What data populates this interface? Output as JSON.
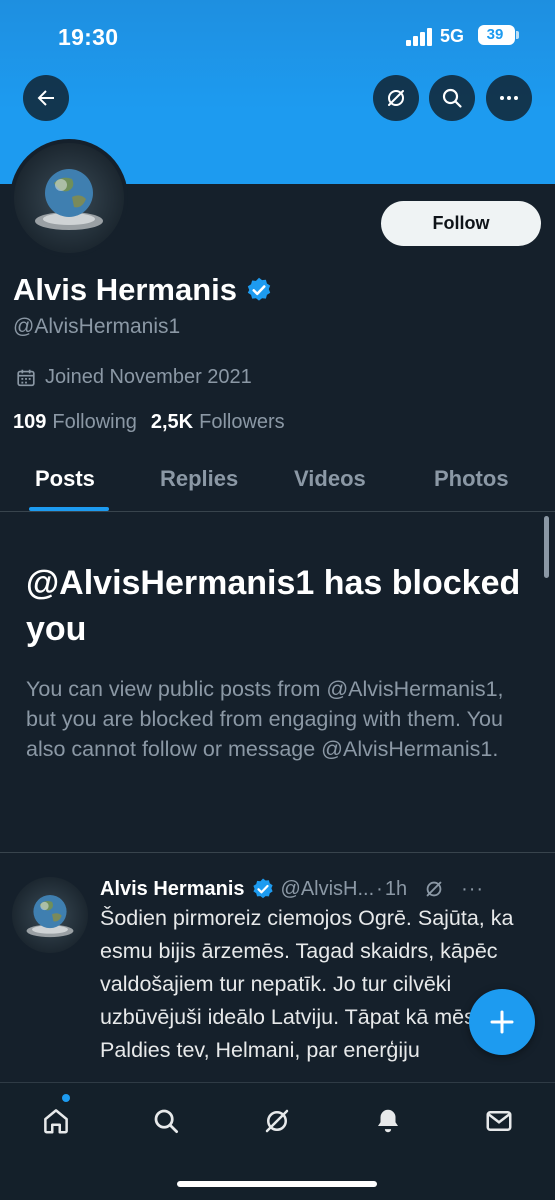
{
  "status_bar": {
    "time": "19:30",
    "network": "5G",
    "battery": "39"
  },
  "header": {
    "back_icon": "arrow-left-icon",
    "grok_icon": "grok-icon",
    "search_icon": "search-icon",
    "more_icon": "more-icon"
  },
  "profile": {
    "follow_label": "Follow",
    "display_name": "Alvis Hermanis",
    "handle": "@AlvisHermanis1",
    "joined": "Joined November 2021",
    "following_count": "109",
    "following_label": "Following",
    "followers_count": "2,5K",
    "followers_label": "Followers"
  },
  "tabs": [
    {
      "label": "Posts",
      "active": true
    },
    {
      "label": "Replies",
      "active": false
    },
    {
      "label": "Videos",
      "active": false
    },
    {
      "label": "Photos",
      "active": false
    }
  ],
  "blocked": {
    "title": "@AlvisHermanis1 has blocked you",
    "description": "You can view public posts from @AlvisHermanis1, but you are blocked from engaging with them. You also cannot follow or message @AlvisHermanis1."
  },
  "post": {
    "name": "Alvis Hermanis",
    "handle": "@AlvisH...",
    "dot": "·",
    "time": "1h",
    "more": "···",
    "text": "Šodien pirmoreiz ciemojos Ogrē. Sajūta, ka esmu bijis ārzemēs. Tagad skaidrs, kāpēc valdošajiem tur nepatīk. Jo tur cilvēki uzbūvējuši ideālo Latviju. Tāpat kā mēs JRT. Paldies tev, Helmani, par enerģiju"
  },
  "bottom_nav": [
    {
      "name": "home",
      "icon": "home-icon"
    },
    {
      "name": "search",
      "icon": "search-icon"
    },
    {
      "name": "grok",
      "icon": "grok-icon"
    },
    {
      "name": "notifications",
      "icon": "bell-icon"
    },
    {
      "name": "messages",
      "icon": "mail-icon"
    }
  ],
  "colors": {
    "background": "#15202b",
    "accent": "#1d9bf0",
    "text_primary": "#e7e9ea",
    "text_secondary": "#8b98a5",
    "divider": "#38444d"
  }
}
